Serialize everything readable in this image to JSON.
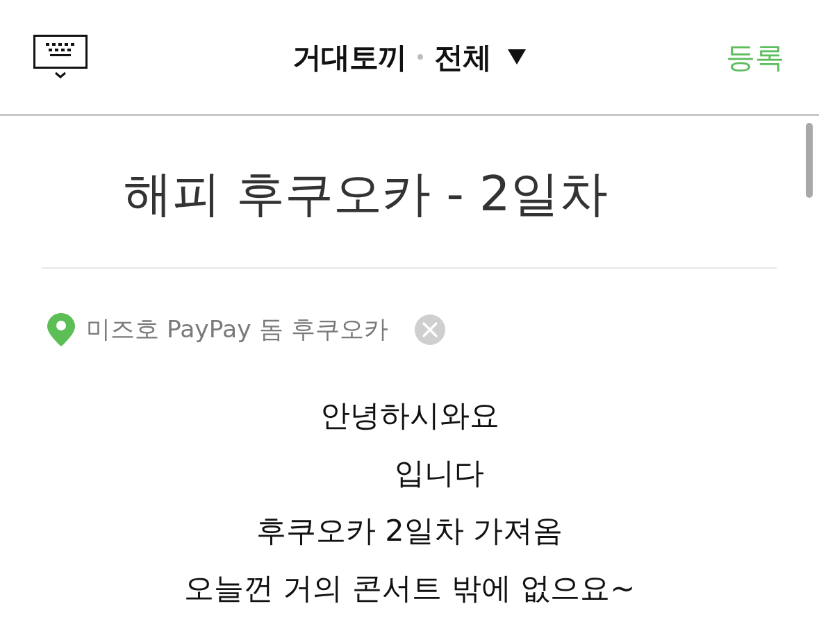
{
  "header": {
    "title": "거대토끼",
    "filter": "전체",
    "action": "등록"
  },
  "post": {
    "title": "해피 후쿠오카 - 2일차",
    "location": {
      "name": "미즈호 PayPay 돔 후쿠오카"
    },
    "body": [
      "안녕하시와요",
      "입니다",
      "후쿠오카 2일차 가져옴",
      "오늘껀 거의 콘서트 밖에 없으요~"
    ]
  }
}
